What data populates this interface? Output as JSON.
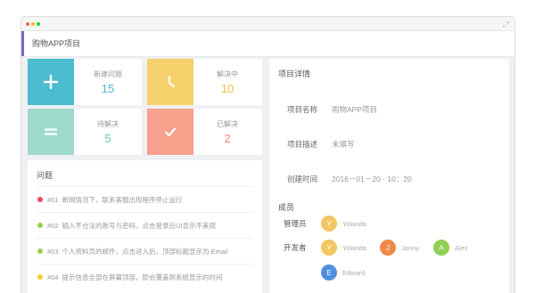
{
  "window": {
    "dots": [
      "#ff5f57",
      "#ffbd2e",
      "#28c940"
    ],
    "expand_icon": "expand-icon"
  },
  "header": {
    "title": "购物APP项目",
    "accent": "#7c68c6"
  },
  "stats": [
    {
      "key": "new",
      "icon": "plus-icon",
      "glyph": "+",
      "label": "新建问题",
      "value": "15",
      "color": "#4cbcd0"
    },
    {
      "key": "resolving",
      "icon": "clock-hand-icon",
      "glyph": "",
      "label": "解决中",
      "value": "10",
      "color": "#f6d16b"
    },
    {
      "key": "pending",
      "icon": "equals-icon",
      "glyph": "=",
      "label": "待解决",
      "value": "5",
      "color": "#9fd9cb"
    },
    {
      "key": "resolved",
      "icon": "check-icon",
      "glyph": "✓",
      "label": "已解决",
      "value": "2",
      "color": "#f7a08c"
    }
  ],
  "issues": {
    "title": "问题",
    "items": [
      {
        "num": "#01",
        "text": "断网情况下，联系客服出现程序停止运行",
        "color": "#f2445f"
      },
      {
        "num": "#02",
        "text": "输入不合法的账号与密码，点击登录后UI显示不美观",
        "color": "#9fcd4a"
      },
      {
        "num": "#03",
        "text": "个人资料页的邮件，点击进入后，顶部标题显示为 Email",
        "color": "#9fcd4a"
      },
      {
        "num": "#04",
        "text": "提示信息全部在屏幕顶部，即会覆盖到系统显示的时间",
        "color": "#f9ca2d"
      }
    ]
  },
  "details": {
    "title": "项目详情",
    "rows": [
      {
        "label": "项目名称",
        "value": "购物APP项目"
      },
      {
        "label": "项目描述",
        "value": "未填写"
      },
      {
        "label": "创建时间",
        "value": "2016－01－20 · 10：20"
      }
    ]
  },
  "members": {
    "title": "成员",
    "admin_label": "管理员",
    "dev_label": "开发者",
    "admins": [
      {
        "initial": "Y",
        "name": "Yolanda",
        "color": "#f2c763"
      }
    ],
    "developers": [
      {
        "initial": "Y",
        "name": "Yolanda",
        "color": "#f2c763"
      },
      {
        "initial": "J",
        "name": "Janny",
        "color": "#ef8a4a"
      },
      {
        "initial": "A",
        "name": "Alex",
        "color": "#8fcf55"
      },
      {
        "initial": "E",
        "name": "Edward",
        "color": "#4f8fe0"
      }
    ]
  }
}
